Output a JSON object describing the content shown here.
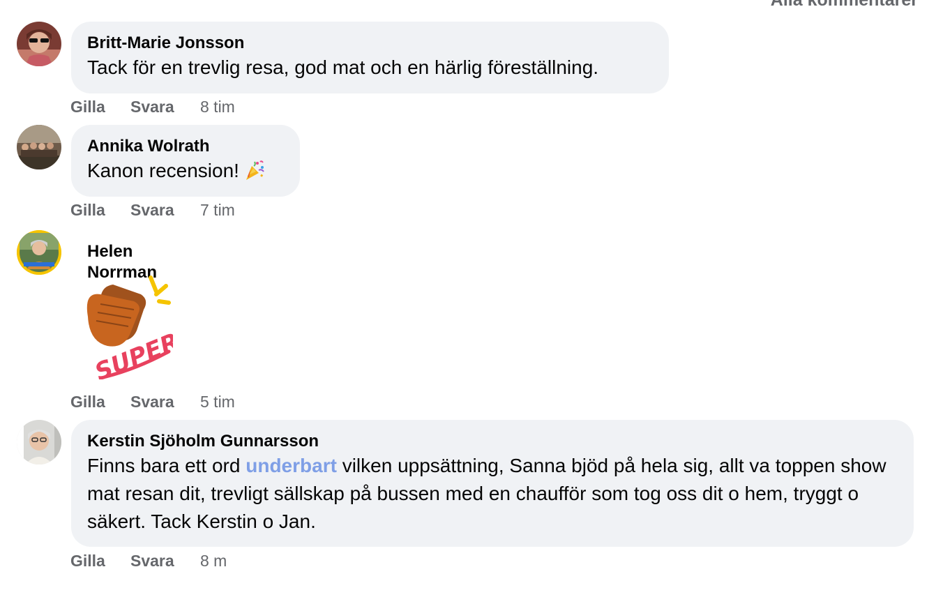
{
  "header": {
    "sort_label": "Alla kommentarer"
  },
  "comments": [
    {
      "author": "Britt-Marie Jonsson",
      "text": "Tack för en trevlig resa, god mat och en härlig föreställning.",
      "like": "Gilla",
      "reply": "Svara",
      "time": "8 tim"
    },
    {
      "author": "Annika Wolrath",
      "text": "Kanon recension!",
      "emoji": "party-popper-icon",
      "like": "Gilla",
      "reply": "Svara",
      "time": "7 tim"
    },
    {
      "author": "Helen Norrman",
      "sticker": "clapping-hands-super-sticker",
      "sticker_text": "SUPER!",
      "like": "Gilla",
      "reply": "Svara",
      "time": "5 tim"
    },
    {
      "author": "Kerstin Sjöholm Gunnarsson",
      "text_before": "Finns bara ett ord ",
      "text_link": "underbart",
      "text_after": " vilken uppsättning, Sanna bjöd på hela sig, allt va toppen show mat resan dit, trevligt sällskap på bussen med en chaufför som tog oss dit o hem, tryggt o säkert. Tack Kerstin o Jan.",
      "like": "Gilla",
      "reply": "Svara",
      "time": "8 m"
    }
  ],
  "colors": {
    "bubble": "#f0f2f5",
    "secondary_text": "#65676b",
    "link": "#7f9fe6",
    "avatar_ring_highlight": "#f5c400"
  }
}
